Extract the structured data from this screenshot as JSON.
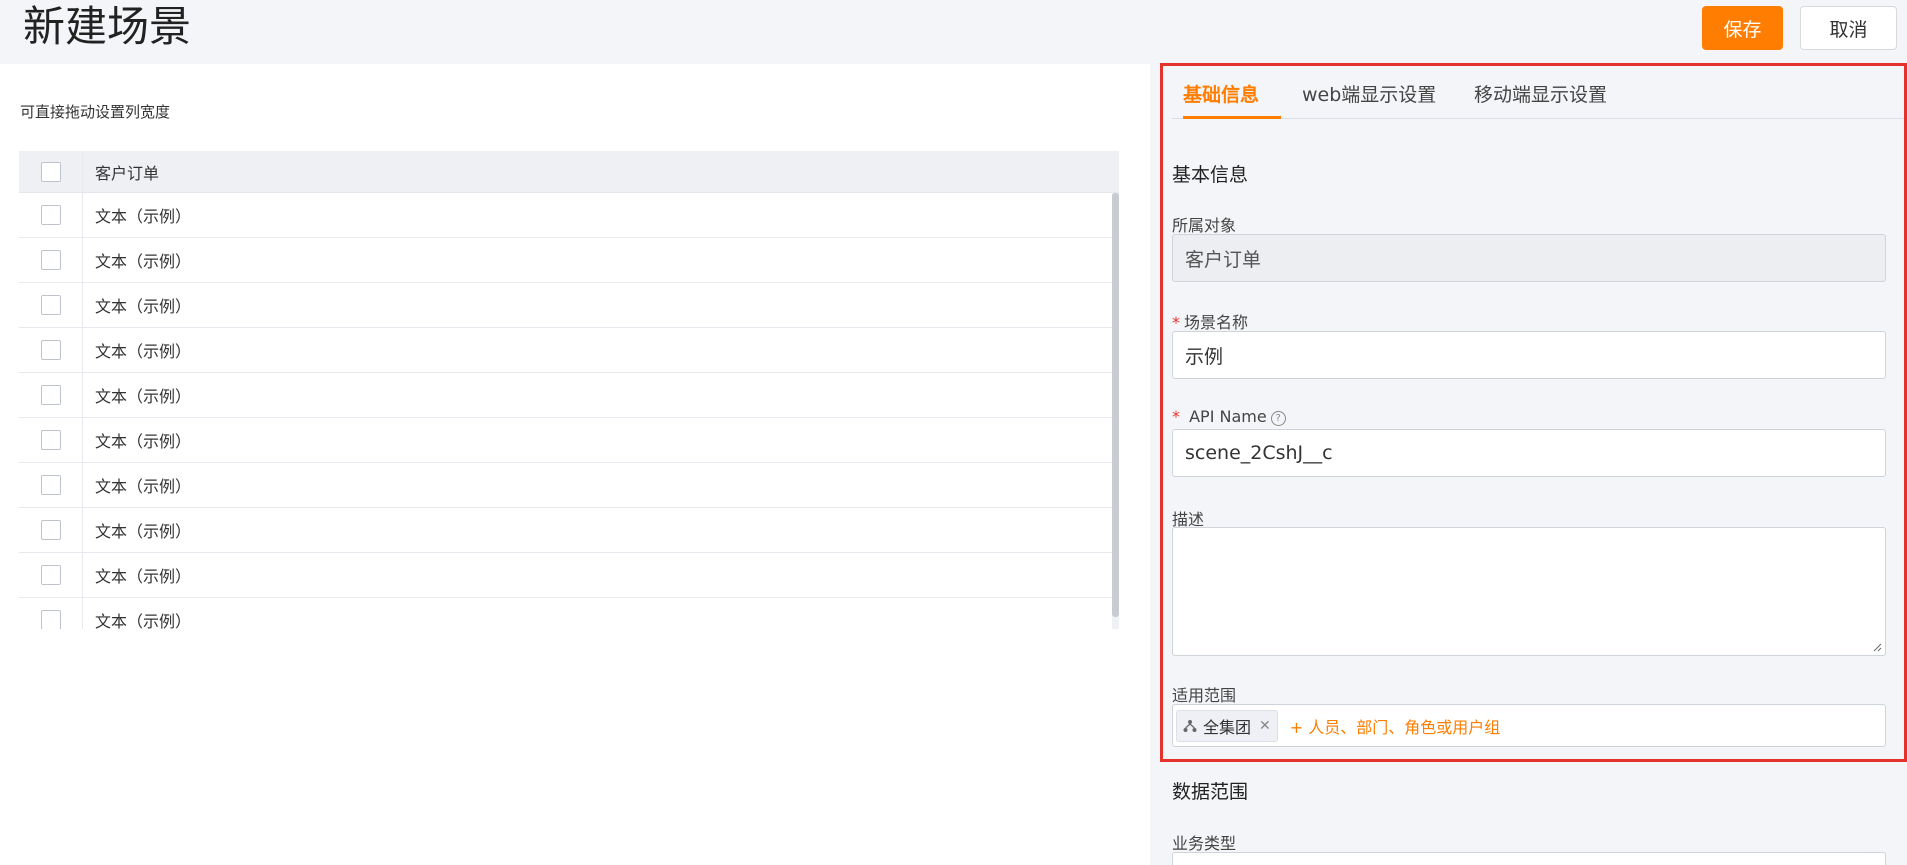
{
  "header": {
    "title": "新建场景",
    "save_label": "保存",
    "cancel_label": "取消"
  },
  "left": {
    "hint": "可直接拖动设置列宽度",
    "table": {
      "header": "客户订单",
      "rows": [
        "文本（示例）",
        "文本（示例）",
        "文本（示例）",
        "文本（示例）",
        "文本（示例）",
        "文本（示例）",
        "文本（示例）",
        "文本（示例）",
        "文本（示例）",
        "文本（示例）"
      ]
    }
  },
  "tabs": [
    "基础信息",
    "web端显示设置",
    "移动端显示设置"
  ],
  "basic": {
    "section_title": "基本信息",
    "object_label": "所属对象",
    "object_value": "客户订单",
    "name_label": "场景名称",
    "name_value": "示例",
    "api_label": "API Name",
    "api_value": "scene_2CshJ__c",
    "desc_label": "描述",
    "desc_value": "",
    "scope_label": "适用范围",
    "scope_tag": "全集团",
    "scope_add": "+ 人员、部门、角色或用户组"
  },
  "data_range": {
    "section_title": "数据范围",
    "biz_type_label": "业务类型"
  },
  "colors": {
    "accent": "#ff7d00",
    "required": "#e5322d",
    "highlight_border": "#e5322d"
  }
}
